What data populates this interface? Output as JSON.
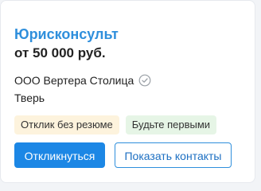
{
  "vacancy": {
    "title": "Юрисконсульт",
    "salary": "от 50 000 руб.",
    "company": "ООО Вертера Столица",
    "company_verified_icon": "check-circle-icon",
    "city": "Тверь",
    "badges": [
      {
        "label": "Отклик без резюме",
        "color": "#fdf3dd"
      },
      {
        "label": "Будьте первыми",
        "color": "#e6f5e6"
      }
    ],
    "actions": {
      "apply_label": "Откликнуться",
      "show_contacts_label": "Показать контакты"
    }
  },
  "colors": {
    "title": "#2f8fdc",
    "primary_button": "#1c87e5",
    "secondary_button_border": "#2f8fdc"
  }
}
